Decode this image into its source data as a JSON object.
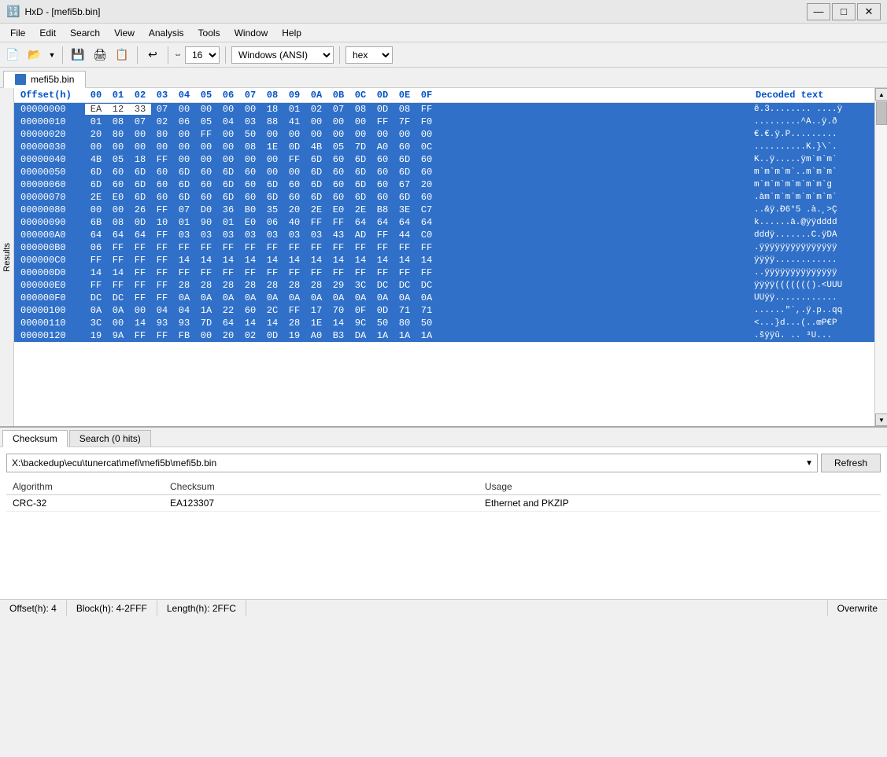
{
  "window": {
    "title": "HxD - [mefi5b.bin]",
    "icon": "🔢"
  },
  "title_buttons": {
    "minimize": "—",
    "maximize": "□",
    "close": "✕"
  },
  "menu_bar": {
    "items": [
      "File",
      "Edit",
      "Search",
      "View",
      "Analysis",
      "Tools",
      "Window",
      "Help"
    ]
  },
  "toolbar": {
    "columns_label": "16",
    "encoding_label": "Windows (ANSI)",
    "display_label": "hex"
  },
  "tab": {
    "label": "mefi5b.bin"
  },
  "hex_header": {
    "offset": "Offset(h)",
    "bytes": [
      "00",
      "01",
      "02",
      "03",
      "04",
      "05",
      "06",
      "07",
      "08",
      "09",
      "0A",
      "0B",
      "0C",
      "0D",
      "0E",
      "0F"
    ],
    "decoded": "Decoded text"
  },
  "hex_rows": [
    {
      "offset": "00000000",
      "bytes": [
        "EA",
        "12",
        "33",
        "07",
        "00",
        "00",
        "00",
        "00",
        "18",
        "01",
        "02",
        "07",
        "08",
        "0D",
        "08",
        "FF"
      ],
      "decoded": "ê.3........ ....ÿ",
      "selected": true,
      "partial": 3
    },
    {
      "offset": "00000010",
      "bytes": [
        "01",
        "08",
        "07",
        "02",
        "06",
        "05",
        "04",
        "03",
        "88",
        "41",
        "00",
        "00",
        "00",
        "FF",
        "7F",
        "F0"
      ],
      "decoded": ".........^A..ÿ.ð",
      "selected": true
    },
    {
      "offset": "00000020",
      "bytes": [
        "20",
        "80",
        "00",
        "80",
        "00",
        "FF",
        "00",
        "50",
        "00",
        "00",
        "00",
        "00",
        "00",
        "00",
        "00",
        "00"
      ],
      "decoded": "€.€.ÿ.P.........",
      "selected": true
    },
    {
      "offset": "00000030",
      "bytes": [
        "00",
        "00",
        "00",
        "00",
        "00",
        "00",
        "00",
        "08",
        "1E",
        "0D",
        "4B",
        "05",
        "7D",
        "A0",
        "60",
        "0C"
      ],
      "decoded": "..........K.}\\`. ",
      "selected": true
    },
    {
      "offset": "00000040",
      "bytes": [
        "4B",
        "05",
        "18",
        "FF",
        "00",
        "00",
        "00",
        "00",
        "00",
        "FF",
        "6D",
        "60",
        "6D",
        "60",
        "6D",
        "60"
      ],
      "decoded": "K..ÿ.....ÿm`m`m`",
      "selected": true
    },
    {
      "offset": "00000050",
      "bytes": [
        "6D",
        "60",
        "6D",
        "60",
        "6D",
        "60",
        "6D",
        "60",
        "00",
        "00",
        "6D",
        "60",
        "6D",
        "60",
        "6D",
        "60"
      ],
      "decoded": "m`m`m`m`..m`m`m`",
      "selected": true
    },
    {
      "offset": "00000060",
      "bytes": [
        "6D",
        "60",
        "6D",
        "60",
        "6D",
        "60",
        "6D",
        "60",
        "6D",
        "60",
        "6D",
        "60",
        "6D",
        "60",
        "67",
        "20"
      ],
      "decoded": "m`m`m`m`m`m`m`g ",
      "selected": true
    },
    {
      "offset": "00000070",
      "bytes": [
        "2E",
        "E0",
        "6D",
        "60",
        "6D",
        "60",
        "6D",
        "60",
        "6D",
        "60",
        "6D",
        "60",
        "6D",
        "60",
        "6D",
        "60"
      ],
      "decoded": ".àm`m`m`m`m`m`m`",
      "selected": true
    },
    {
      "offset": "00000080",
      "bytes": [
        "00",
        "00",
        "26",
        "FF",
        "07",
        "D0",
        "36",
        "B0",
        "35",
        "20",
        "2E",
        "E0",
        "2E",
        "B8",
        "3E",
        "C7"
      ],
      "decoded": "..&ÿ.Ð6°5 .à.¸>Ç",
      "selected": true
    },
    {
      "offset": "00000090",
      "bytes": [
        "6B",
        "08",
        "0D",
        "10",
        "01",
        "90",
        "01",
        "E0",
        "06",
        "40",
        "FF",
        "FF",
        "64",
        "64",
        "64",
        "64"
      ],
      "decoded": "k......à.@ÿÿdddd",
      "selected": true
    },
    {
      "offset": "000000A0",
      "bytes": [
        "64",
        "64",
        "64",
        "FF",
        "03",
        "03",
        "03",
        "03",
        "03",
        "03",
        "03",
        "43",
        "AD",
        "FF",
        "44",
        "C0"
      ],
      "decoded": "dddÿ.......C.ÿDÀ",
      "selected": true
    },
    {
      "offset": "000000B0",
      "bytes": [
        "06",
        "FF",
        "FF",
        "FF",
        "FF",
        "FF",
        "FF",
        "FF",
        "FF",
        "FF",
        "FF",
        "FF",
        "FF",
        "FF",
        "FF",
        "FF"
      ],
      "decoded": ".ÿÿÿÿÿÿÿÿÿÿÿÿÿÿÿ",
      "selected": true
    },
    {
      "offset": "000000C0",
      "bytes": [
        "FF",
        "FF",
        "FF",
        "FF",
        "14",
        "14",
        "14",
        "14",
        "14",
        "14",
        "14",
        "14",
        "14",
        "14",
        "14",
        "14"
      ],
      "decoded": "ÿÿÿÿ............",
      "selected": true
    },
    {
      "offset": "000000D0",
      "bytes": [
        "14",
        "14",
        "FF",
        "FF",
        "FF",
        "FF",
        "FF",
        "FF",
        "FF",
        "FF",
        "FF",
        "FF",
        "FF",
        "FF",
        "FF",
        "FF"
      ],
      "decoded": "..ÿÿÿÿÿÿÿÿÿÿÿÿÿÿ",
      "selected": true
    },
    {
      "offset": "000000E0",
      "bytes": [
        "FF",
        "FF",
        "FF",
        "FF",
        "28",
        "28",
        "28",
        "28",
        "28",
        "28",
        "28",
        "29",
        "3C",
        "DC",
        "DC",
        "DC"
      ],
      "decoded": "ÿÿÿÿ((((((().<ÜÜÜ",
      "selected": true
    },
    {
      "offset": "000000F0",
      "bytes": [
        "DC",
        "DC",
        "FF",
        "FF",
        "0A",
        "0A",
        "0A",
        "0A",
        "0A",
        "0A",
        "0A",
        "0A",
        "0A",
        "0A",
        "0A",
        "0A"
      ],
      "decoded": "ÜÜÿÿ............",
      "selected": true
    },
    {
      "offset": "00000100",
      "bytes": [
        "0A",
        "0A",
        "00",
        "04",
        "04",
        "1A",
        "22",
        "60",
        "2C",
        "FF",
        "17",
        "70",
        "0F",
        "0D",
        "71",
        "71"
      ],
      "decoded": "......\"`,.ÿ.p..qq",
      "selected": true
    },
    {
      "offset": "00000110",
      "bytes": [
        "3C",
        "00",
        "14",
        "93",
        "93",
        "7D",
        "64",
        "14",
        "14",
        "28",
        "1E",
        "14",
        "9C",
        "50",
        "80",
        "50"
      ],
      "decoded": "<...}d...(..œP€P",
      "selected": true
    },
    {
      "offset": "00000120",
      "bytes": [
        "19",
        "9A",
        "FF",
        "FF",
        "FB",
        "00",
        "20",
        "02",
        "0D",
        "19",
        "A0",
        "B3",
        "DA",
        "1A",
        "1A",
        "1A"
      ],
      "decoded": ".šÿÿû. .. ³Ú...",
      "selected": true
    }
  ],
  "bottom_panel": {
    "tabs": [
      "Checksum",
      "Search (0 hits)"
    ],
    "active_tab": "Checksum",
    "filepath": "X:\\backedup\\ecu\\tunercat\\mefi\\mefi5b\\mefi5b.bin",
    "refresh_button": "Refresh",
    "table": {
      "headers": [
        "Algorithm",
        "Checksum",
        "Usage"
      ],
      "rows": [
        {
          "algorithm": "CRC-32",
          "checksum": "EA123307",
          "usage": "Ethernet and PKZIP"
        }
      ]
    }
  },
  "results_sidebar": {
    "label": "Results"
  },
  "status_bar": {
    "offset": "Offset(h): 4",
    "block": "Block(h): 4-2FFF",
    "length": "Length(h): 2FFC",
    "mode": "Overwrite"
  }
}
